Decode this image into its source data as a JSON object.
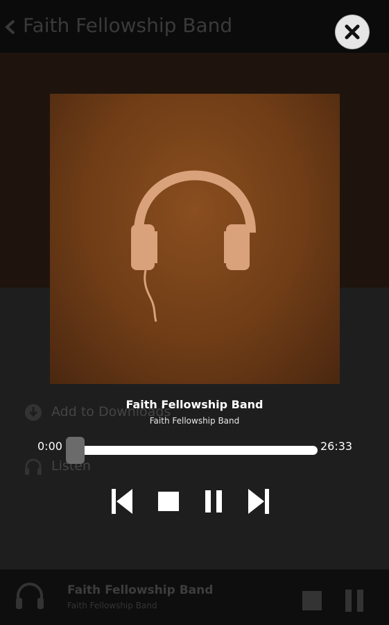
{
  "app_header": {
    "title": "Faith Fellowship Band",
    "back_icon": "chevron-left-icon"
  },
  "background_list": {
    "items": [
      {
        "label": "Add to Downloads",
        "icon": "download-icon"
      },
      {
        "label": "Listen",
        "icon": "headphones-icon"
      }
    ]
  },
  "mini_player": {
    "title": "Faith Fellowship Band",
    "subtitle": "Faith Fellowship Band",
    "icon": "headphones-icon"
  },
  "player": {
    "close_icon": "close-icon",
    "track_title": "Faith Fellowship Band",
    "track_artist": "Faith Fellowship Band",
    "time_current": "0:00",
    "time_total": "26:33",
    "progress_fraction": 0.0,
    "controls": [
      "previous-icon",
      "stop-icon",
      "pause-icon",
      "next-icon"
    ]
  },
  "colors": {
    "album_bg": "#6e3c16",
    "headphones": "#d9a27b"
  }
}
